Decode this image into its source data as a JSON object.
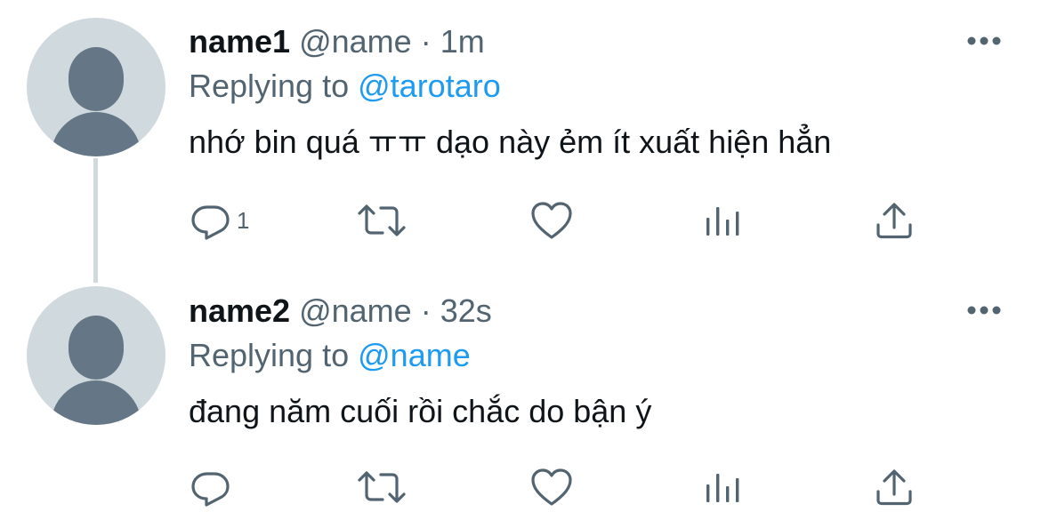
{
  "colors": {
    "text": "#0f1419",
    "muted": "#536471",
    "link": "#1d9bf0",
    "avatar_bg": "#cfd9de",
    "avatar_fg": "#657786"
  },
  "tweets": [
    {
      "name": "name1",
      "handle": "@name",
      "dot": "·",
      "time": "1m",
      "replying_prefix": "Replying to",
      "replying_to": "@tarotaro",
      "text": "nhớ bin quá ㅠㅠ dạo này ẻm ít xuất hiện hẳn",
      "reply_count": "1",
      "icons": [
        "reply-icon",
        "retweet-icon",
        "like-icon",
        "views-icon",
        "share-icon",
        "more-icon"
      ]
    },
    {
      "name": "name2",
      "handle": "@name",
      "dot": "·",
      "time": "32s",
      "replying_prefix": "Replying to",
      "replying_to": "@name",
      "text": "đang năm cuối rồi chắc do bận ý",
      "reply_count": "",
      "icons": [
        "reply-icon",
        "retweet-icon",
        "like-icon",
        "views-icon",
        "share-icon",
        "more-icon"
      ]
    }
  ]
}
